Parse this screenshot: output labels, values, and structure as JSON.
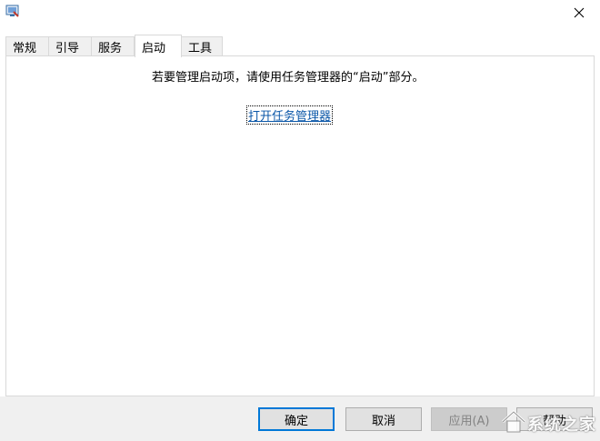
{
  "window": {
    "close_glyph": "✕"
  },
  "tabs": [
    {
      "label": "常规",
      "active": false
    },
    {
      "label": "引导",
      "active": false
    },
    {
      "label": "服务",
      "active": false
    },
    {
      "label": "启动",
      "active": true
    },
    {
      "label": "工具",
      "active": false
    }
  ],
  "startup": {
    "info_text": "若要管理启动项，请使用任务管理器的“启动”部分。",
    "link_text": "打开任务管理器"
  },
  "footer": {
    "ok_label": "确定",
    "cancel_label": "取消",
    "apply_label": "应用(A)",
    "help_label": "帮助"
  },
  "watermark": {
    "text": "系统之家"
  },
  "colors": {
    "accent": "#0078d7",
    "link": "#0b57a8",
    "footer_bg": "#f0f0f0"
  }
}
